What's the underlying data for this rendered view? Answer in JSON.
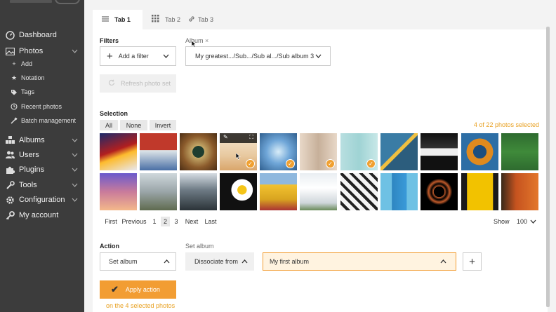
{
  "sidebar": {
    "items": [
      {
        "label": "Dashboard",
        "icon": "dashboard-icon"
      },
      {
        "label": "Photos",
        "icon": "photos-icon"
      },
      {
        "label": "Albums",
        "icon": "albums-icon"
      },
      {
        "label": "Users",
        "icon": "users-icon"
      },
      {
        "label": "Plugins",
        "icon": "plugins-icon"
      },
      {
        "label": "Tools",
        "icon": "tools-icon"
      },
      {
        "label": "Configuration",
        "icon": "configuration-icon"
      },
      {
        "label": "My account",
        "icon": "my-account-icon"
      }
    ],
    "photos_sub": [
      {
        "label": "Add",
        "icon": "plus-icon"
      },
      {
        "label": "Notation",
        "icon": "star-icon"
      },
      {
        "label": "Tags",
        "icon": "tag-icon"
      },
      {
        "label": "Recent photos",
        "icon": "clock-icon"
      },
      {
        "label": "Batch management",
        "icon": "batch-icon"
      }
    ]
  },
  "tabs": [
    {
      "label": "Tab 1",
      "icon": "hamburger-icon"
    },
    {
      "label": "Tab 2",
      "icon": "grid-icon"
    },
    {
      "label": "Tab 3",
      "icon": "link-icon"
    }
  ],
  "filters": {
    "label": "Filters",
    "add_filter": "Add a filter",
    "album_filter_label": "Album",
    "album_filter_close": "×",
    "album_value": "My greatest.../Sub.../Sub al.../Sub album 3",
    "refresh": "Refresh photo set"
  },
  "selection": {
    "label": "Selection",
    "all": "All",
    "none": "None",
    "invert": "Invert",
    "count": "4 of 22 photos selected"
  },
  "photos": [
    {
      "selected": false
    },
    {
      "selected": false
    },
    {
      "selected": false
    },
    {
      "selected": true,
      "hover": true
    },
    {
      "selected": true
    },
    {
      "selected": true
    },
    {
      "selected": true
    },
    {
      "selected": false
    },
    {
      "selected": false
    },
    {
      "selected": false
    },
    {
      "selected": false
    },
    {
      "selected": false
    },
    {
      "selected": false
    },
    {
      "selected": false
    },
    {
      "selected": false
    },
    {
      "selected": false
    },
    {
      "selected": false
    },
    {
      "selected": false
    },
    {
      "selected": false
    },
    {
      "selected": false
    },
    {
      "selected": false
    },
    {
      "selected": false
    }
  ],
  "pager": {
    "first": "First",
    "previous": "Previous",
    "pages": [
      "1",
      "2",
      "3"
    ],
    "current": "2",
    "next": "Next",
    "last": "Last",
    "show_label": "Show",
    "show_value": "100"
  },
  "action": {
    "label": "Action",
    "set_album_label": "Set album",
    "action_value": "Set album",
    "mode_value": "Dissociate from",
    "album_value": "My first album",
    "add_button": "+",
    "apply": "Apply action",
    "note": "on the 4 selected photos"
  },
  "colors": {
    "accent": "#f29d33",
    "sidebar": "#3c3c3c"
  }
}
